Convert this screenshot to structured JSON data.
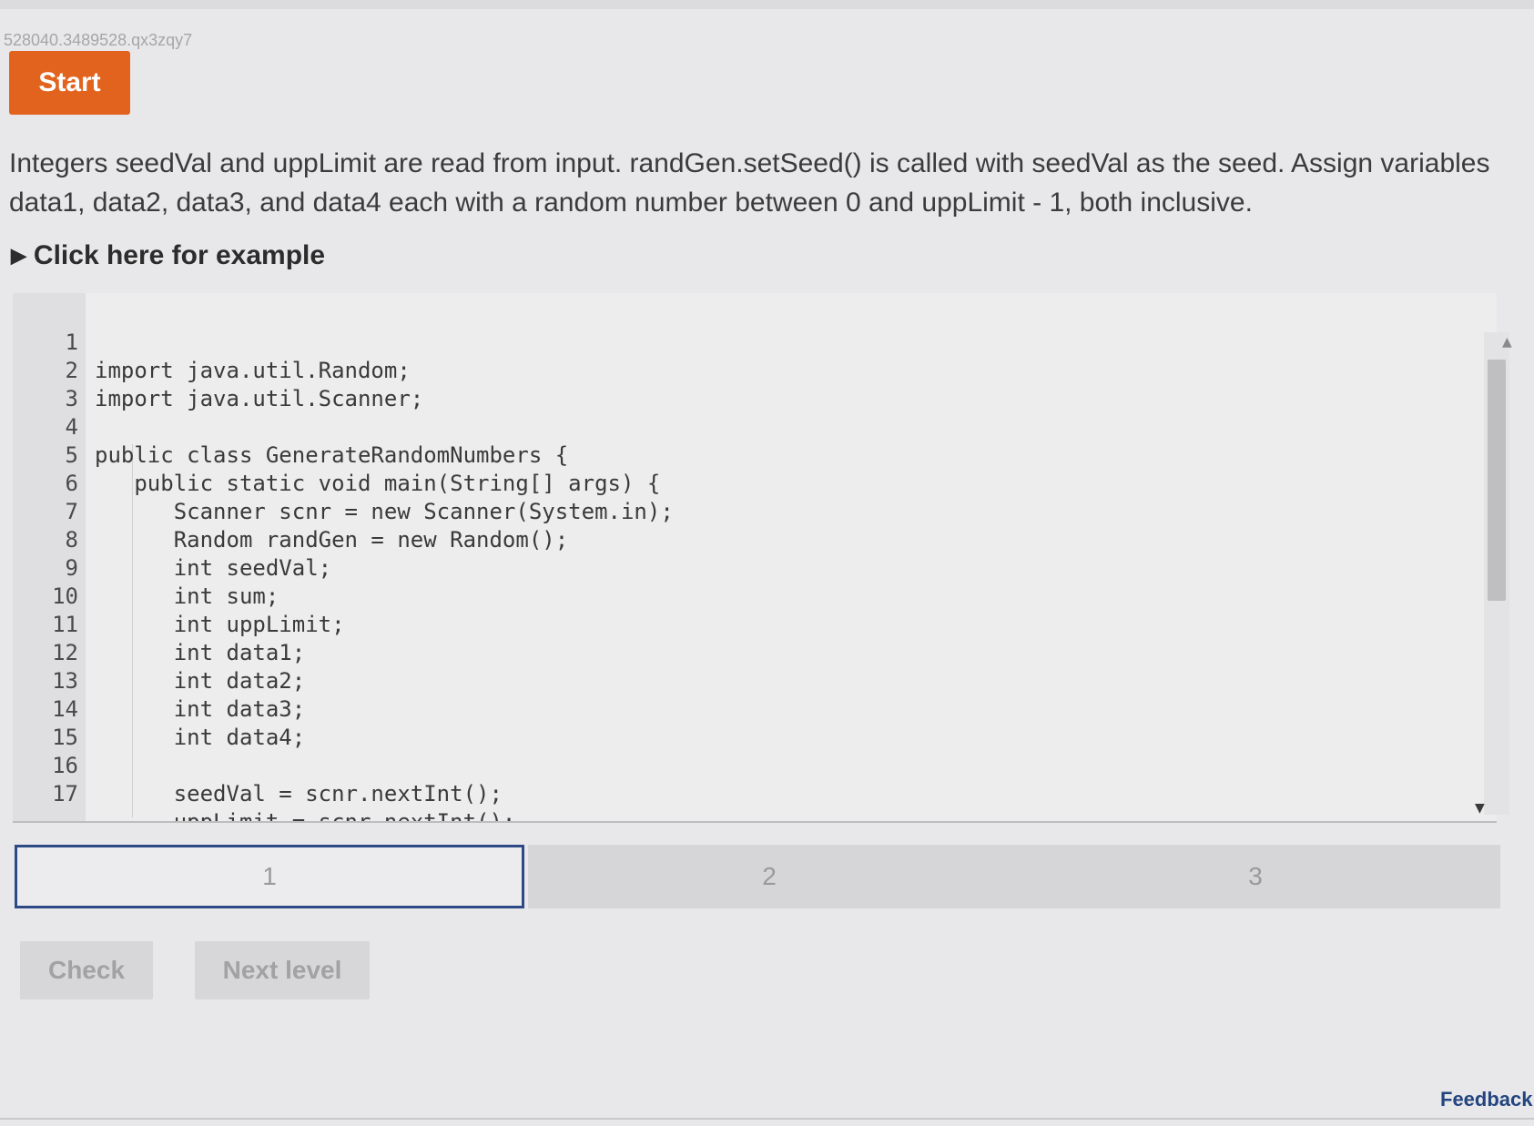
{
  "header": {
    "activity_id": "528040.3489528.qx3zqy7",
    "start_label": "Start"
  },
  "instructions": {
    "text": "Integers seedVal and uppLimit are read from input. randGen.setSeed() is called with seedVal as the seed. Assign variables data1, data2, data3, and data4 each with a random number between 0 and uppLimit - 1, both inclusive.",
    "example_toggle": "Click here for example"
  },
  "code": {
    "lines": [
      {
        "num": "1",
        "text": "import java.util.Random;"
      },
      {
        "num": "2",
        "text": "import java.util.Scanner;"
      },
      {
        "num": "3",
        "text": ""
      },
      {
        "num": "4",
        "text": "public class GenerateRandomNumbers {"
      },
      {
        "num": "5",
        "text": "   public static void main(String[] args) {"
      },
      {
        "num": "6",
        "text": "      Scanner scnr = new Scanner(System.in);"
      },
      {
        "num": "7",
        "text": "      Random randGen = new Random();"
      },
      {
        "num": "8",
        "text": "      int seedVal;"
      },
      {
        "num": "9",
        "text": "      int sum;"
      },
      {
        "num": "10",
        "text": "      int uppLimit;"
      },
      {
        "num": "11",
        "text": "      int data1;"
      },
      {
        "num": "12",
        "text": "      int data2;"
      },
      {
        "num": "13",
        "text": "      int data3;"
      },
      {
        "num": "14",
        "text": "      int data4;"
      },
      {
        "num": "15",
        "text": ""
      },
      {
        "num": "16",
        "text": "      seedVal = scnr.nextInt();"
      },
      {
        "num": "17",
        "text": "      uppLimit = scnr.nextInt();"
      }
    ]
  },
  "progress": {
    "segments": [
      "1",
      "2",
      "3"
    ],
    "active": "1"
  },
  "actions": {
    "check_label": "Check",
    "next_level_label": "Next level"
  },
  "footer": {
    "feedback_label": "Feedback"
  },
  "colors": {
    "start_button": "#e2631e",
    "active_segment_border": "#2d4a86",
    "feedback_link": "#23457f"
  }
}
